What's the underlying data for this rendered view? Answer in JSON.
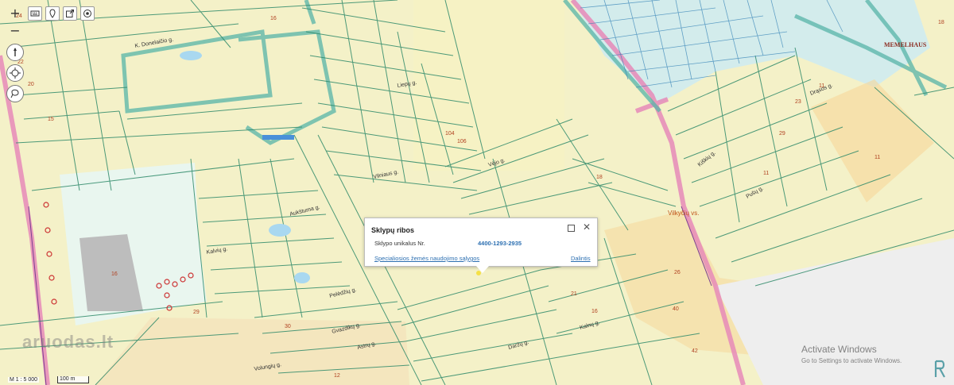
{
  "toolbar": {
    "icons": [
      "plus-icon",
      "keyboard-icon",
      "marker-icon",
      "export-icon",
      "target-icon"
    ]
  },
  "zoom": {
    "in_label": "+",
    "out_label": "−"
  },
  "popup": {
    "title": "Sklypų ribos",
    "field_label": "Sklypo unikalus Nr.",
    "field_value": "4400-1293-2935",
    "link_left": "Specialiosios žemės naudojimo sąlygos",
    "link_right": "Dalintis"
  },
  "map": {
    "scale_text": "M 1 : 5 000",
    "scale_bar_label": "100 m",
    "watermark": "aruodas.lt",
    "logo_text": "MEMELHAUS",
    "street_labels": [
      "Aukštuma g.",
      "Vilniaus g.",
      "Liepų g.",
      "Vėjo g.",
      "Gvazdikų g.",
      "Astrų g.",
      "Pelėdžių g.",
      "Volungių g.",
      "Kalnų g.",
      "Daržų g.",
      "Drąsos g.",
      "Kiškių g.",
      "Pušų g.",
      "K. Donelaičio g.",
      "Kalvių g.",
      "Vilkyčių vs."
    ],
    "colors": {
      "parcel_fill": "#f4f1c8",
      "parcel_line": "#2f8a6a",
      "road": "#e9a5c8",
      "cadastre_blue": "#4aa6d6",
      "popup_link": "#2c6fb1"
    }
  },
  "system": {
    "activate_title": "Activate Windows",
    "activate_sub": "Go to Settings to activate Windows."
  }
}
